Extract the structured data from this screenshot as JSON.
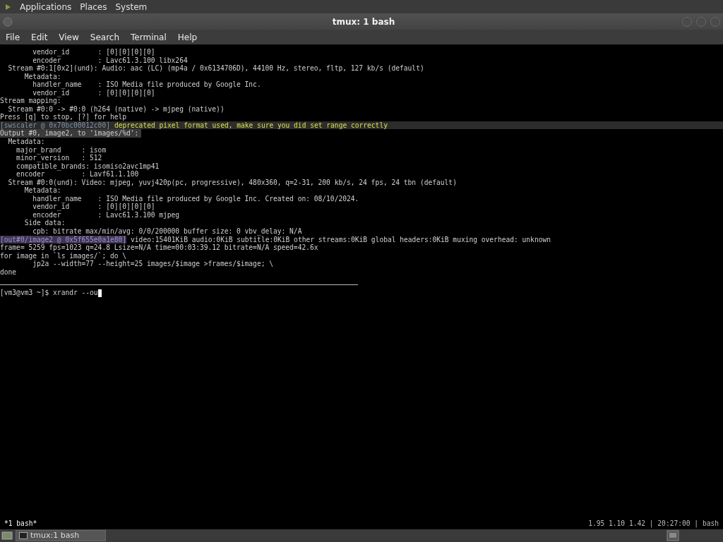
{
  "top_panel": {
    "menus": [
      "Applications",
      "Places",
      "System"
    ]
  },
  "window": {
    "title": "tmux: 1 bash"
  },
  "menubar": [
    "File",
    "Edit",
    "View",
    "Search",
    "Terminal",
    "Help"
  ],
  "terminal": {
    "lines": [
      {
        "kind": "plain",
        "text": "        vendor_id       : [0][0][0][0]"
      },
      {
        "kind": "plain",
        "text": "        encoder         : Lavc61.3.100 libx264"
      },
      {
        "kind": "plain",
        "text": "  Stream #0:1[0x2](und): Audio: aac (LC) (mp4a / 0x6134706D), 44100 Hz, stereo, fltp, 127 kb/s (default)"
      },
      {
        "kind": "plain",
        "text": "      Metadata:"
      },
      {
        "kind": "plain",
        "text": "        handler_name    : ISO Media file produced by Google Inc."
      },
      {
        "kind": "plain",
        "text": "        vendor_id       : [0][0][0][0]"
      },
      {
        "kind": "plain",
        "text": "Stream mapping:"
      },
      {
        "kind": "plain",
        "text": "  Stream #0:0 -> #0:0 (h264 (native) -> mjpeg (native))"
      },
      {
        "kind": "plain",
        "text": "Press [q] to stop, [?] for help"
      },
      {
        "kind": "warning",
        "tag": "[swscaler @ 0x70bc00012c00]",
        "text": "deprecated pixel format used, make sure you did set range correctly"
      },
      {
        "kind": "highlight",
        "text": "Output #0, image2, to 'images/%d':"
      },
      {
        "kind": "plain",
        "text": "  Metadata:"
      },
      {
        "kind": "plain",
        "text": "    major_brand     : isom"
      },
      {
        "kind": "plain",
        "text": "    minor_version   : 512"
      },
      {
        "kind": "plain",
        "text": "    compatible_brands: isomiso2avc1mp41"
      },
      {
        "kind": "plain",
        "text": "    encoder         : Lavf61.1.100"
      },
      {
        "kind": "plain",
        "text": "  Stream #0:0(und): Video: mjpeg, yuvj420p(pc, progressive), 480x360, q=2-31, 200 kb/s, 24 fps, 24 tbn (default)"
      },
      {
        "kind": "plain",
        "text": "      Metadata:"
      },
      {
        "kind": "plain",
        "text": "        handler_name    : ISO Media file produced by Google Inc. Created on: 08/10/2024."
      },
      {
        "kind": "plain",
        "text": "        vendor_id       : [0][0][0][0]"
      },
      {
        "kind": "plain",
        "text": "        encoder         : Lavc61.3.100 mjpeg"
      },
      {
        "kind": "plain",
        "text": "      Side data:"
      },
      {
        "kind": "plain",
        "text": "        cpb: bitrate max/min/avg: 0/0/200000 buffer size: 0 vbv_delay: N/A"
      },
      {
        "kind": "tagged",
        "tag": "[out#0/image2 @ 0x5f655e0a1e80]",
        "text": "video:15401KiB audio:0KiB subtitle:0KiB other streams:0KiB global headers:0KiB muxing overhead: unknown"
      },
      {
        "kind": "plain",
        "text": "frame= 5259 fps=1023 q=24.8 Lsize=N/A time=00:03:39.12 bitrate=N/A speed=42.6x"
      },
      {
        "kind": "plain",
        "text": "for image in `ls images/`; do \\"
      },
      {
        "kind": "plain",
        "text": "        jp2a --width=77 --height=25 images/$image >frames/$image; \\"
      },
      {
        "kind": "plain",
        "text": "done"
      }
    ],
    "prompt": "[vm3@vm3 ~]$ xrandr --ou"
  },
  "tmux_status": {
    "window": "*1 bash*",
    "right": "1.95 1.10 1.42 | 20:27:00 | bash"
  },
  "taskbar": {
    "task": "tmux:1 bash"
  }
}
